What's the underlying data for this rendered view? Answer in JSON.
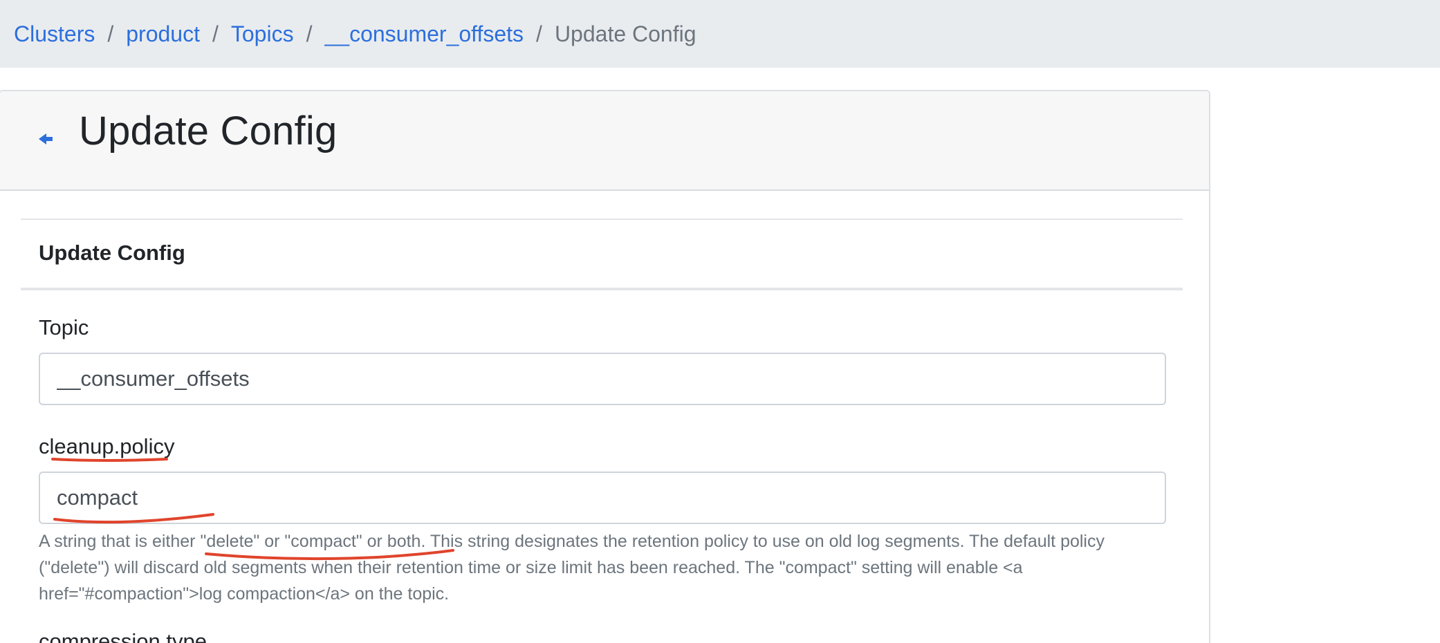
{
  "breadcrumb": {
    "items": [
      "Clusters",
      "product",
      "Topics",
      "__consumer_offsets"
    ],
    "separator": "/",
    "current": "Update Config"
  },
  "header": {
    "title": "Update Config",
    "back_icon": "arrow-left-icon"
  },
  "section": {
    "title": "Update Config"
  },
  "fields": {
    "topic": {
      "label": "Topic",
      "value": "__consumer_offsets"
    },
    "cleanup_policy": {
      "label": "cleanup.policy",
      "value": "compact",
      "help": "A string that is either \"delete\" or \"compact\" or both. This string designates the retention policy to use on old log segments. The default policy (\"delete\") will discard old segments when their retention time or size limit has been reached. The \"compact\" setting will enable <a href=\"#compaction\">log compaction</a> on the topic."
    },
    "next_label": "compression.type"
  },
  "colors": {
    "link": "#2c6fdc",
    "annotation": "#e0442c",
    "muted": "#6c757d"
  }
}
